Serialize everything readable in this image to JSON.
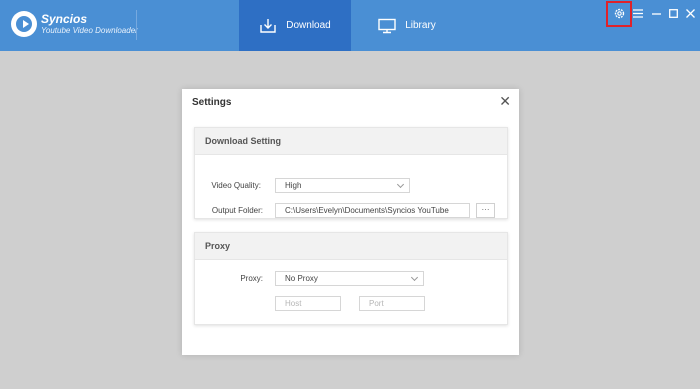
{
  "app": {
    "name": "Syncios",
    "subtitle": "Youtube Video Downloader"
  },
  "tabs": [
    {
      "label": "Download",
      "active": true,
      "icon": "download-icon"
    },
    {
      "label": "Library",
      "active": false,
      "icon": "monitor-icon"
    }
  ],
  "window_controls": {
    "settings_icon": "gear-icon",
    "menu_icon": "hamburger-icon",
    "minimize_icon": "minimize-icon",
    "maximize_icon": "maximize-icon",
    "close_icon": "close-icon"
  },
  "dialog": {
    "title": "Settings",
    "close_glyph": "✕",
    "download_section": {
      "heading": "Download Setting",
      "video_quality_label": "Video Quality:",
      "video_quality_value": "High",
      "output_folder_label": "Output Folder:",
      "output_folder_value": "C:\\Users\\Evelyn\\Documents\\Syncios YouTube",
      "browse_label": "···"
    },
    "proxy_section": {
      "heading": "Proxy",
      "proxy_label": "Proxy:",
      "proxy_value": "No Proxy",
      "host_placeholder": "Host",
      "port_placeholder": "Port"
    }
  },
  "colors": {
    "topbar": "#4a8fd4",
    "active_tab": "#2e6fc4",
    "highlight": "#e0222a",
    "background": "#cfcfcf"
  }
}
